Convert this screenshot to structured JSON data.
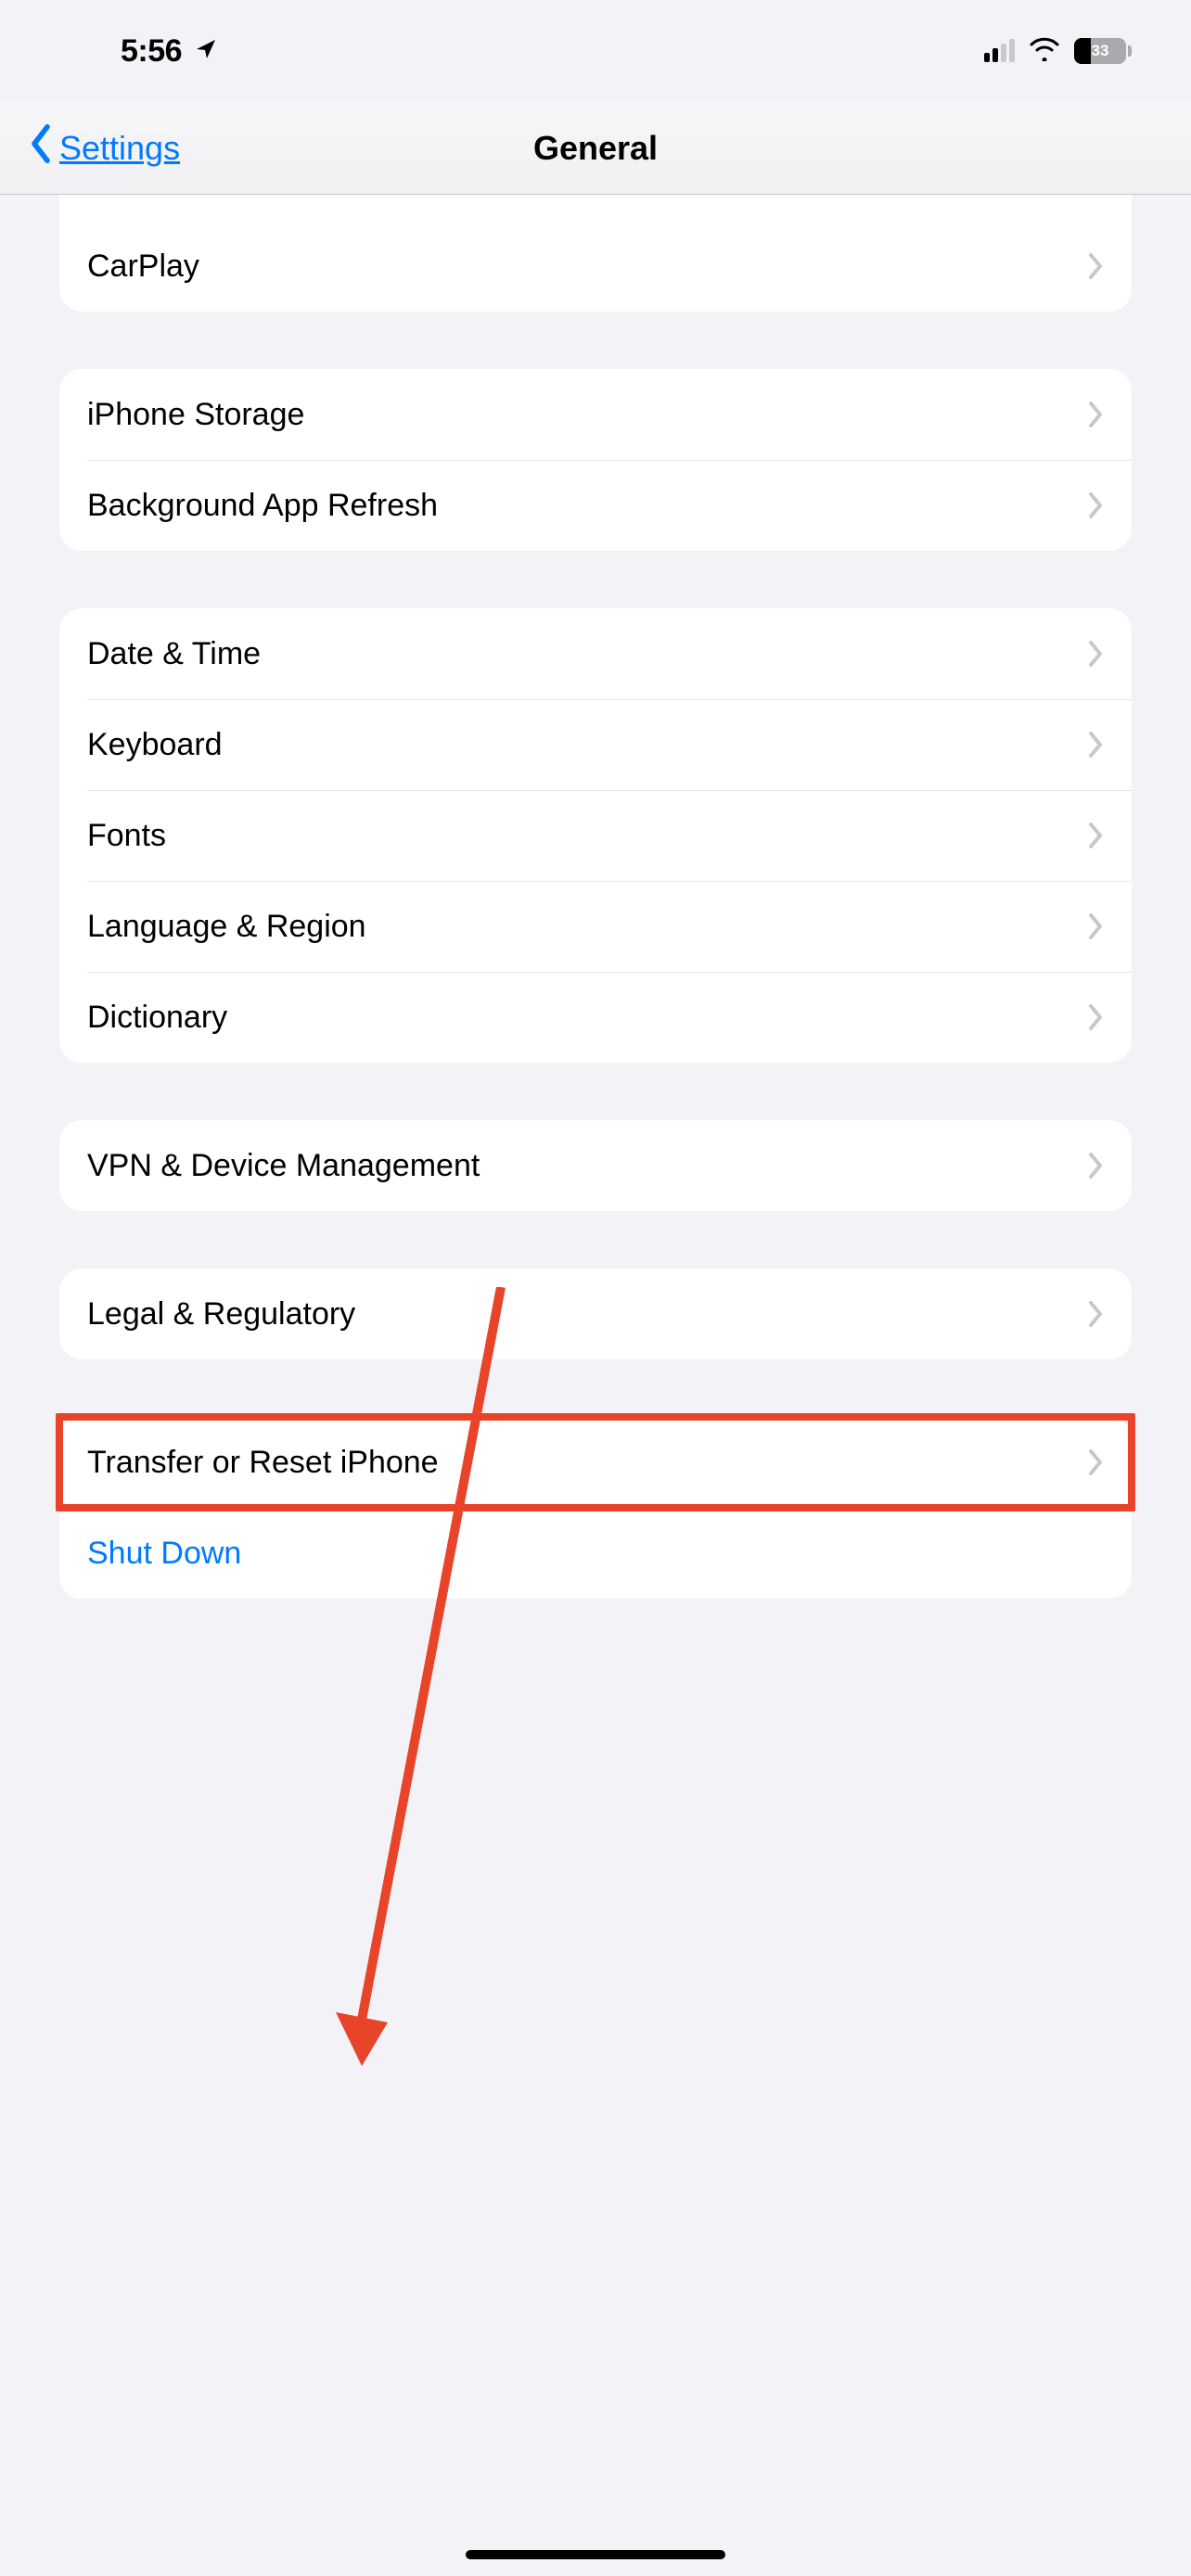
{
  "status": {
    "time": "5:56",
    "battery_pct": "33",
    "signal_bars_active": 2
  },
  "nav": {
    "back_label": "Settings",
    "title": "General"
  },
  "groups": [
    {
      "rows": [
        {
          "label": "CarPlay",
          "chevron": true
        }
      ],
      "partialTop": true
    },
    {
      "rows": [
        {
          "label": "iPhone Storage",
          "chevron": true
        },
        {
          "label": "Background App Refresh",
          "chevron": true
        }
      ]
    },
    {
      "rows": [
        {
          "label": "Date & Time",
          "chevron": true
        },
        {
          "label": "Keyboard",
          "chevron": true
        },
        {
          "label": "Fonts",
          "chevron": true
        },
        {
          "label": "Language & Region",
          "chevron": true
        },
        {
          "label": "Dictionary",
          "chevron": true
        }
      ]
    },
    {
      "rows": [
        {
          "label": "VPN & Device Management",
          "chevron": true
        }
      ]
    },
    {
      "rows": [
        {
          "label": "Legal & Regulatory",
          "chevron": true
        }
      ]
    },
    {
      "rows": [
        {
          "label": "Transfer or Reset iPhone",
          "chevron": true,
          "highlighted": true
        },
        {
          "label": "Shut Down",
          "chevron": false,
          "link": true
        }
      ]
    }
  ],
  "annotation": {
    "arrow_color": "#e8442a",
    "highlight_color": "#e8442a"
  }
}
